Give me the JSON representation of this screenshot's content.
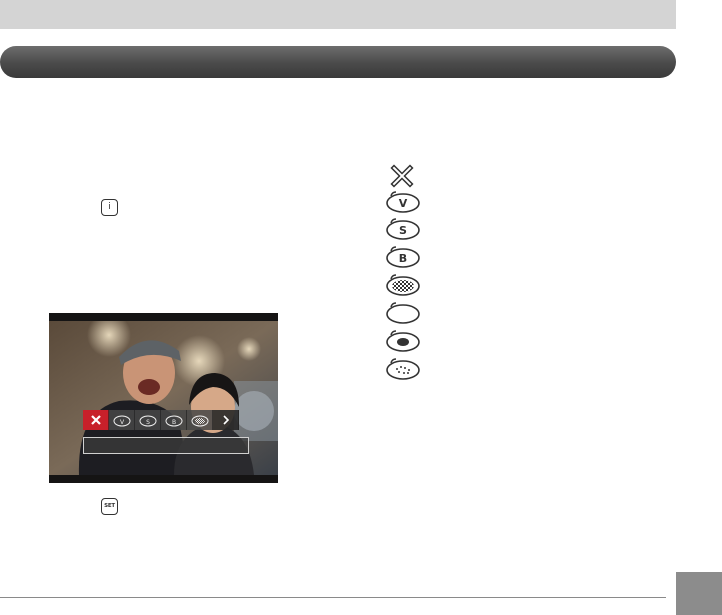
{
  "keys": {
    "info_key": "i",
    "set_key": "SET"
  },
  "effect_icons": [
    {
      "name": "off-icon"
    },
    {
      "name": "vivid-icon",
      "letter": "V"
    },
    {
      "name": "stylish-icon",
      "letter": "S"
    },
    {
      "name": "bold-icon",
      "letter": "B"
    },
    {
      "name": "checker-icon"
    },
    {
      "name": "plain-swirl-icon"
    },
    {
      "name": "spot-icon"
    },
    {
      "name": "dotted-icon"
    }
  ],
  "screen": {
    "strip_letters": [
      "V",
      "S",
      "B"
    ]
  },
  "colors": {
    "selected": "#c8202a",
    "header": "#4a4a4a"
  }
}
